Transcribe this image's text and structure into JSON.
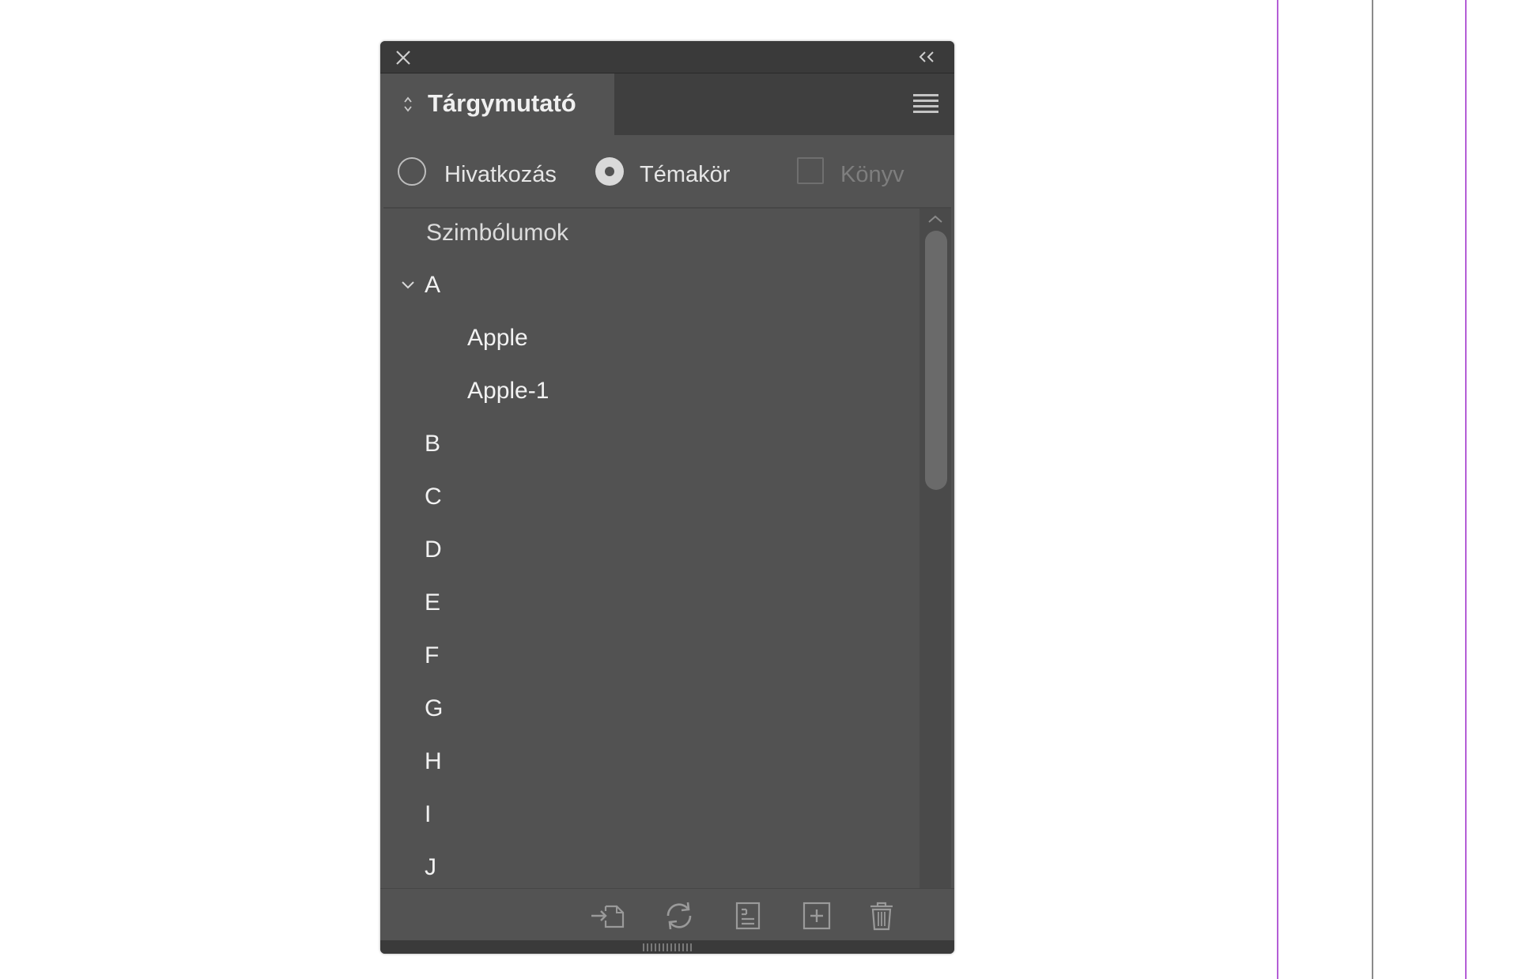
{
  "panel": {
    "title": "Tárgymutató",
    "close_icon": "close-icon",
    "collapse_icon": "double-chevron-left-icon",
    "menu_icon": "panel-menu-icon"
  },
  "options": {
    "reference_label": "Hivatkozás",
    "reference_selected": false,
    "topic_label": "Témakör",
    "topic_selected": true,
    "book_label": "Könyv",
    "book_enabled": false,
    "book_checked": false
  },
  "index": {
    "symbols_label": "Szimbólumok",
    "groups": [
      {
        "letter": "A",
        "expanded": true,
        "topics": [
          "Apple",
          "Apple-1"
        ]
      },
      {
        "letter": "B"
      },
      {
        "letter": "C"
      },
      {
        "letter": "D"
      },
      {
        "letter": "E"
      },
      {
        "letter": "F"
      },
      {
        "letter": "G"
      },
      {
        "letter": "H"
      },
      {
        "letter": "I"
      },
      {
        "letter": "J"
      }
    ]
  },
  "footer": {
    "icons": [
      "go-to-marker-icon",
      "update-preview-icon",
      "generate-index-icon",
      "new-entry-icon",
      "delete-icon"
    ]
  },
  "colors": {
    "panel_bg": "#535353",
    "titlebar_bg": "#3a3a3a",
    "guide_purple": "#b45ed6"
  }
}
